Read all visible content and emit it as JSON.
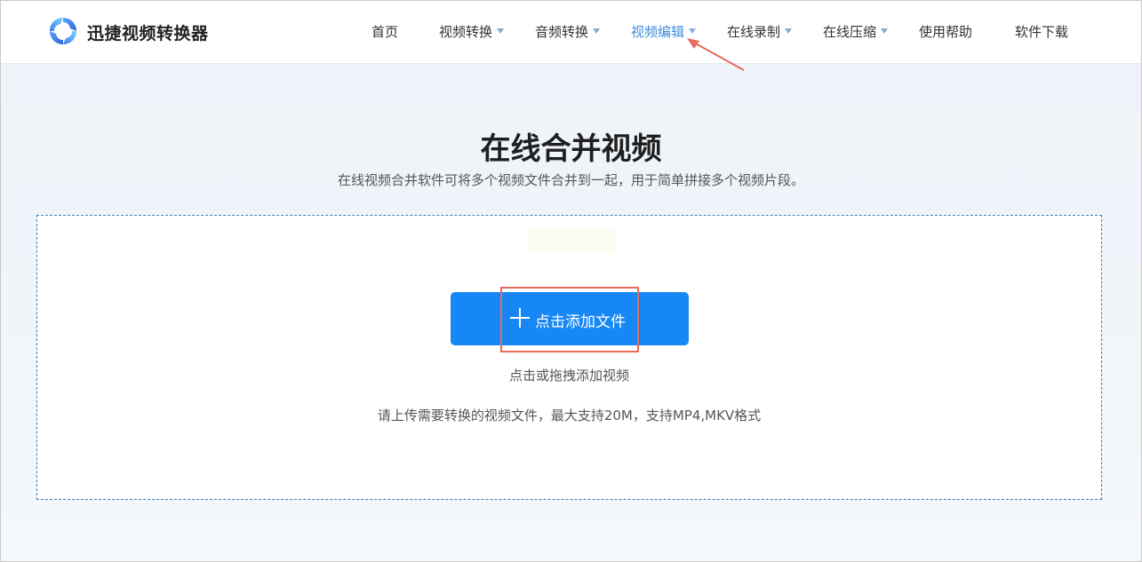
{
  "header": {
    "brand": "迅捷视频转换器",
    "nav": [
      {
        "label": "首页",
        "has_dropdown": false,
        "active": false
      },
      {
        "label": "视频转换",
        "has_dropdown": true,
        "active": false
      },
      {
        "label": "音频转换",
        "has_dropdown": true,
        "active": false
      },
      {
        "label": "视频编辑",
        "has_dropdown": true,
        "active": true
      },
      {
        "label": "在线录制",
        "has_dropdown": true,
        "active": false
      },
      {
        "label": "在线压缩",
        "has_dropdown": true,
        "active": false
      },
      {
        "label": "使用帮助",
        "has_dropdown": false,
        "active": false
      },
      {
        "label": "软件下载",
        "has_dropdown": false,
        "active": false
      }
    ],
    "active_color": "#3a8ed8"
  },
  "main": {
    "title": "在线合并视频",
    "subtitle": "在线视频合并软件可将多个视频文件合并到一起，用于简单拼接多个视频片段。",
    "upload": {
      "button_icon": "plus-icon",
      "button_label": "点击添加文件",
      "button_color": "#1787f5",
      "hint": "点击或拖拽添加视频",
      "note": "请上传需要转换的视频文件，最大支持20M，支持MP4,MKV格式"
    }
  },
  "annotations": {
    "highlight_color": "#e7695a"
  }
}
